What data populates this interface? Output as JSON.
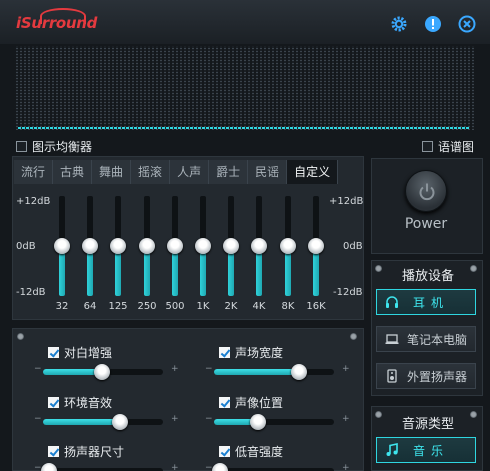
{
  "app": {
    "logo_text": "iSurround"
  },
  "titlebar": {
    "settings_icon": "gear-icon",
    "info_icon": "info-icon",
    "close_icon": "close-icon"
  },
  "toggles": {
    "show_eq_label": "图示均衡器",
    "show_eq_checked": false,
    "spectrum_label": "语谱图",
    "spectrum_checked": false
  },
  "presets": [
    "流行",
    "古典",
    "舞曲",
    "摇滚",
    "人声",
    "爵士",
    "民谣",
    "自定义"
  ],
  "active_preset": "自定义",
  "eq": {
    "top_label": "+12dB",
    "mid_label": "0dB",
    "bottom_label": "-12dB",
    "bands": [
      {
        "freq": "32",
        "gain_db": 0
      },
      {
        "freq": "64",
        "gain_db": 0
      },
      {
        "freq": "125",
        "gain_db": 0
      },
      {
        "freq": "250",
        "gain_db": 0
      },
      {
        "freq": "500",
        "gain_db": 0
      },
      {
        "freq": "1K",
        "gain_db": 0
      },
      {
        "freq": "2K",
        "gain_db": 0
      },
      {
        "freq": "4K",
        "gain_db": 0
      },
      {
        "freq": "8K",
        "gain_db": 0
      },
      {
        "freq": "16K",
        "gain_db": 0
      }
    ]
  },
  "effects": [
    {
      "label": "对白增强",
      "checked": true,
      "level": 0.49
    },
    {
      "label": "声场宽度",
      "checked": true,
      "level": 0.71
    },
    {
      "label": "环境音效",
      "checked": true,
      "level": 0.64
    },
    {
      "label": "声像位置",
      "checked": true,
      "level": 0.37
    },
    {
      "label": "扬声器尺寸",
      "checked": true,
      "level": 0.05
    },
    {
      "label": "低音强度",
      "checked": true,
      "level": 0.05
    }
  ],
  "power": {
    "label": "Power"
  },
  "playback": {
    "title": "播放设备",
    "options": [
      {
        "label": "耳机",
        "icon": "headphones-icon",
        "active": true
      },
      {
        "label": "笔记本电脑",
        "icon": "laptop-icon",
        "active": false
      },
      {
        "label": "外置扬声器",
        "icon": "speaker-icon",
        "active": false
      }
    ]
  },
  "source": {
    "title": "音源类型",
    "options": [
      {
        "label": "音乐",
        "icon": "music-note-icon",
        "active": true
      }
    ]
  },
  "colors": {
    "accent": "#2fd6e0",
    "logo": "#e43a3f",
    "background": "#14181c"
  }
}
